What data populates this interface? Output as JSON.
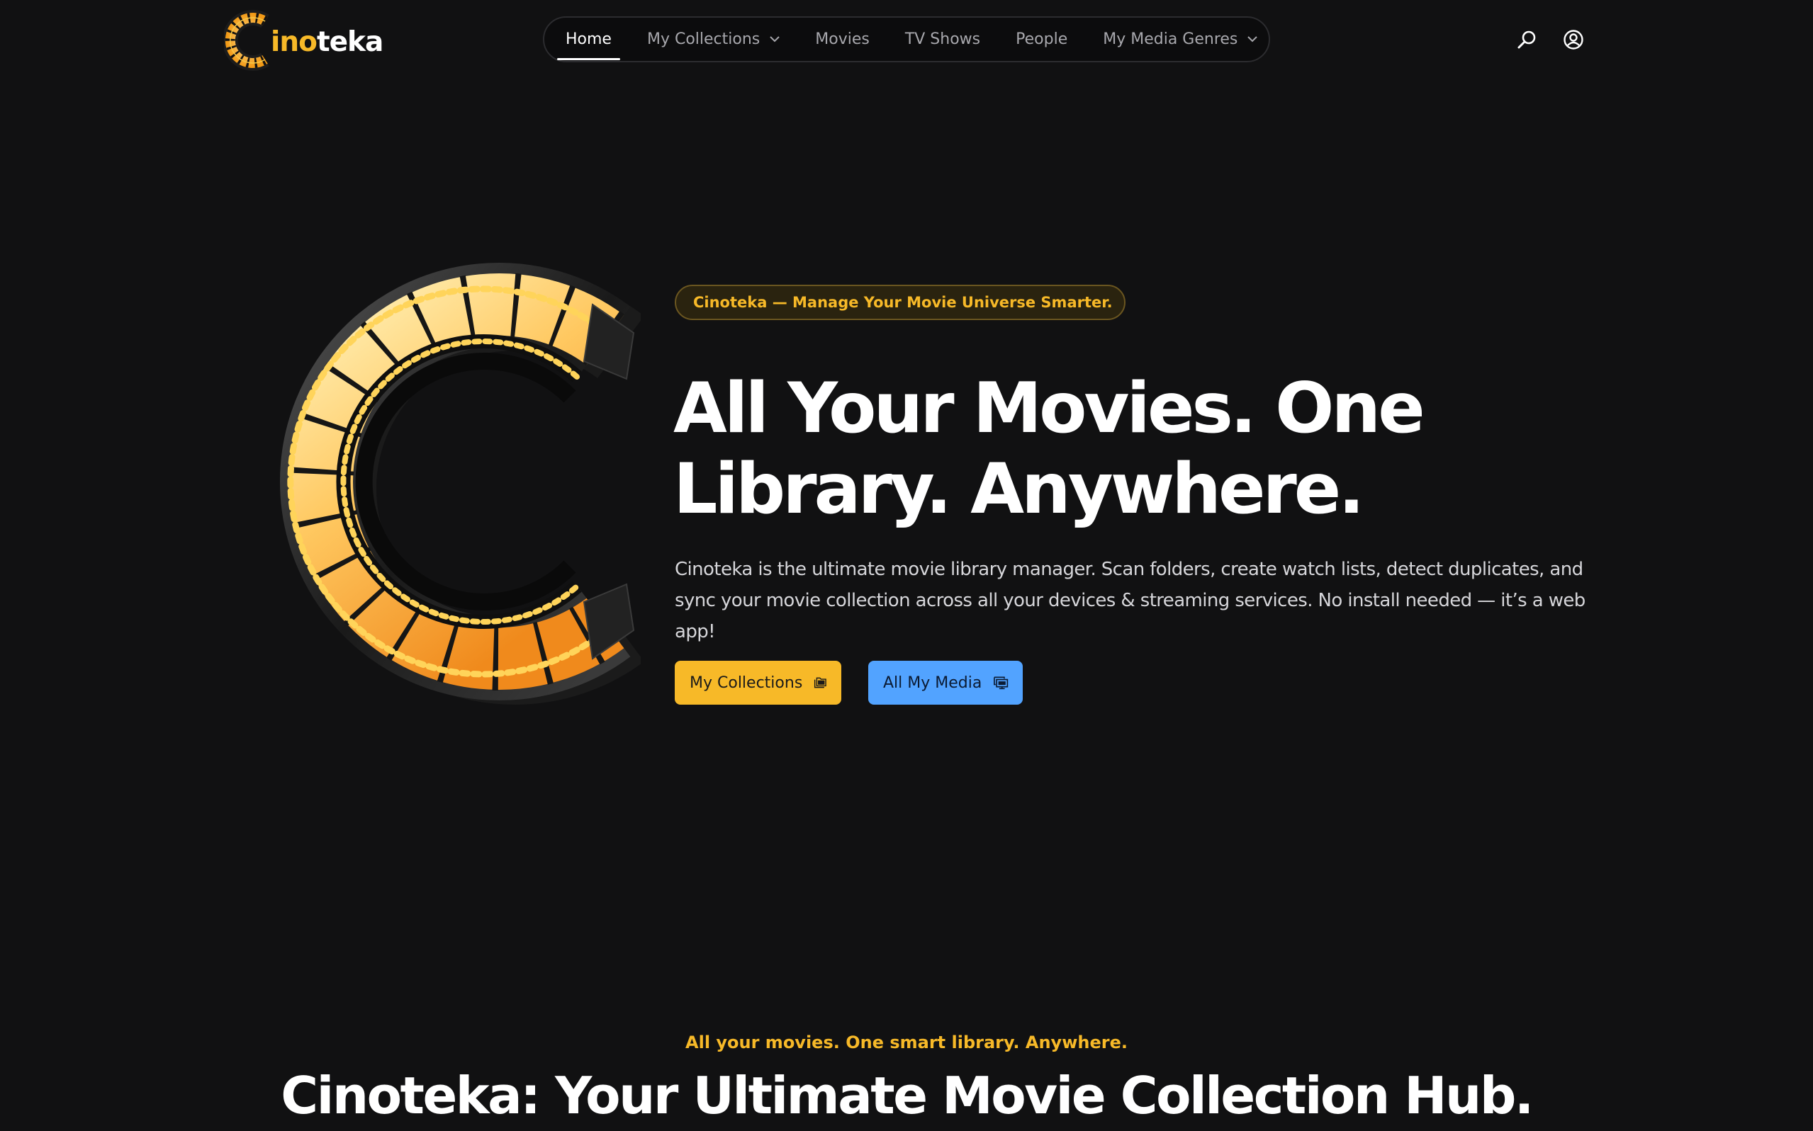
{
  "brand": {
    "name_part1": "ino",
    "name_part2": "teka",
    "logo_icon": "film-reel-c-logo"
  },
  "nav": {
    "items": [
      {
        "label": "Home",
        "active": true,
        "dropdown": false
      },
      {
        "label": "My Collections",
        "active": false,
        "dropdown": true
      },
      {
        "label": "Movies",
        "active": false,
        "dropdown": false
      },
      {
        "label": "TV Shows",
        "active": false,
        "dropdown": false
      },
      {
        "label": "People",
        "active": false,
        "dropdown": false
      },
      {
        "label": "My Media Genres",
        "active": false,
        "dropdown": true
      }
    ]
  },
  "header_icons": [
    "search-icon",
    "user-account-icon"
  ],
  "hero": {
    "badge": "Cinoteka — Manage Your Movie Universe Smarter.",
    "title_line1": "All Your Movies. One",
    "title_line2": "Library. Anywhere.",
    "description": "Cinoteka is the ultimate movie library manager. Scan folders, create watch lists, detect duplicates, and sync your movie collection across all your devices & streaming services. No install needed — it’s a web app!",
    "primary_button": "My Collections",
    "secondary_button": "All My Media",
    "art_icon": "film-reel-c-illustration"
  },
  "section": {
    "kicker": "All your movies. One smart library. Anywhere.",
    "title": "Cinoteka: Your Ultimate Movie Collection Hub."
  },
  "colors": {
    "background": "#111112",
    "accent_yellow": "#f7b928",
    "accent_blue": "#52a3ff",
    "nav_text": "#a8a8ad"
  }
}
